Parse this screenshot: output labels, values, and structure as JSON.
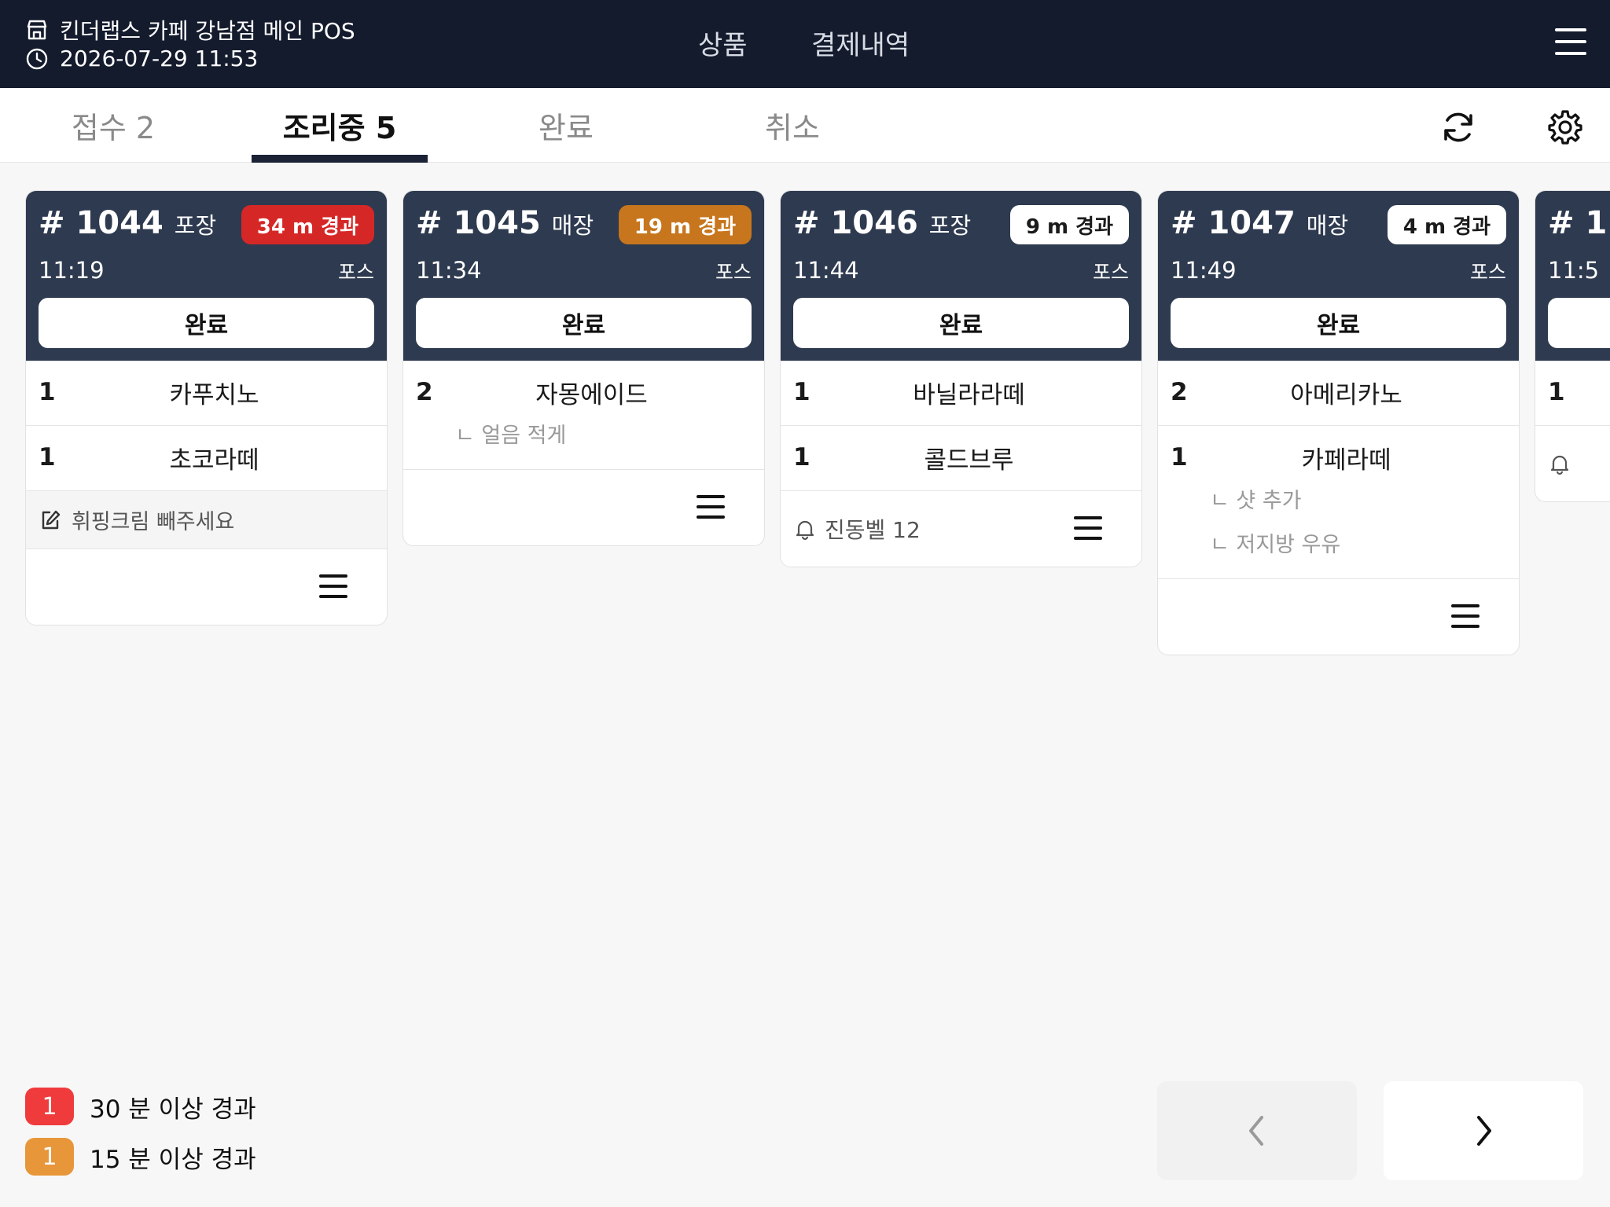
{
  "header": {
    "store_name": "킨더랩스 카페 강남점 메인 POS",
    "datetime": "2026-07-29 11:53",
    "nav": [
      "상품",
      "결제내역"
    ]
  },
  "tabs": [
    {
      "label": "접수 2",
      "active": false
    },
    {
      "label": "조리중 5",
      "active": true
    },
    {
      "label": "완료",
      "active": false
    },
    {
      "label": "취소",
      "active": false
    }
  ],
  "orders": [
    {
      "number": "# 1044",
      "type": "포장",
      "elapsed": "34 m 경과",
      "elapsed_level": "red",
      "time": "11:19",
      "source": "포스",
      "done_label": "완료",
      "items": [
        {
          "qty": "1",
          "name": "카푸치노",
          "options": []
        },
        {
          "qty": "1",
          "name": "초코라떼",
          "options": []
        }
      ],
      "memo": "휘핑크림 빼주세요",
      "bell": ""
    },
    {
      "number": "# 1045",
      "type": "매장",
      "elapsed": "19 m 경과",
      "elapsed_level": "orange",
      "time": "11:34",
      "source": "포스",
      "done_label": "완료",
      "items": [
        {
          "qty": "2",
          "name": "자몽에이드",
          "options": [
            "ㄴ 얼음 적게"
          ]
        }
      ],
      "memo": "",
      "bell": ""
    },
    {
      "number": "# 1046",
      "type": "포장",
      "elapsed": "9 m 경과",
      "elapsed_level": "normal",
      "time": "11:44",
      "source": "포스",
      "done_label": "완료",
      "items": [
        {
          "qty": "1",
          "name": "바닐라라떼",
          "options": []
        },
        {
          "qty": "1",
          "name": "콜드브루",
          "options": []
        }
      ],
      "memo": "",
      "bell": "진동벨 12"
    },
    {
      "number": "# 1047",
      "type": "매장",
      "elapsed": "4 m 경과",
      "elapsed_level": "normal",
      "time": "11:49",
      "source": "포스",
      "done_label": "완료",
      "items": [
        {
          "qty": "2",
          "name": "아메리카노",
          "options": []
        },
        {
          "qty": "1",
          "name": "카페라떼",
          "options": [
            "ㄴ 샷 추가",
            "ㄴ 저지방 우유"
          ]
        }
      ],
      "memo": "",
      "bell": ""
    },
    {
      "number": "# 1",
      "time": "11:5",
      "qty": "1"
    }
  ],
  "legend": [
    {
      "count": "1",
      "label": "30 분 이상 경과",
      "color": "#ef3b3b"
    },
    {
      "count": "1",
      "label": "15 분 이상 경과",
      "color": "#e8963a"
    }
  ],
  "colors": {
    "header_bg": "#141b2d",
    "card_head_bg": "#2e3a4f",
    "red": "#d62727",
    "orange": "#c7761e"
  }
}
